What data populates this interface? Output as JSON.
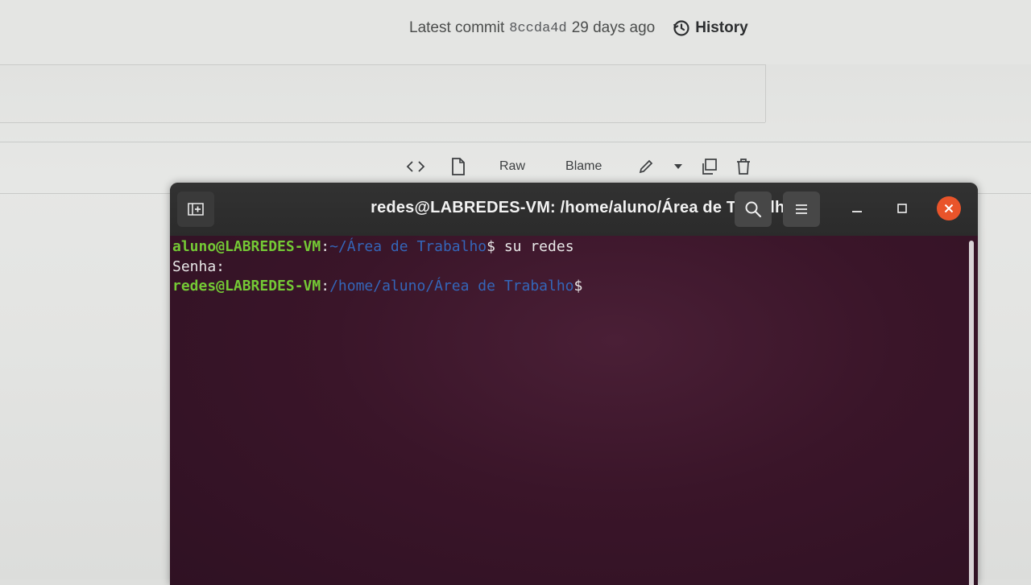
{
  "background_page": {
    "commit": {
      "label": "Latest commit",
      "sha": "8ccda4d",
      "age": "29 days ago",
      "history_label": "History"
    },
    "file_toolbar": {
      "raw_label": "Raw",
      "blame_label": "Blame"
    }
  },
  "terminal": {
    "title": "redes@LABREDES-VM: /home/aluno/Área de Trabalho",
    "lines": [
      {
        "user_host": "aluno@LABREDES-VM",
        "sep": ":",
        "path": "~/Área de Trabalho",
        "prompt": "$",
        "command": " su redes"
      },
      {
        "text": "Senha:"
      },
      {
        "user_host": "redes@LABREDES-VM",
        "sep": ":",
        "path": "/home/aluno/Área de Trabalho",
        "prompt": "$",
        "command": ""
      }
    ]
  },
  "colors": {
    "terminal_bg": "#3a1529",
    "titlebar_bg": "#2f2f2f",
    "prompt_user": "#74c935",
    "prompt_path": "#3466b9",
    "close_button": "#e9542a"
  },
  "icons": [
    "history-icon",
    "code-icon",
    "file-icon",
    "pencil-icon",
    "caret-down-icon",
    "copy-icon",
    "trash-icon",
    "new-tab-icon",
    "search-icon",
    "hamburger-menu-icon",
    "minimize-icon",
    "maximize-icon",
    "close-icon"
  ]
}
